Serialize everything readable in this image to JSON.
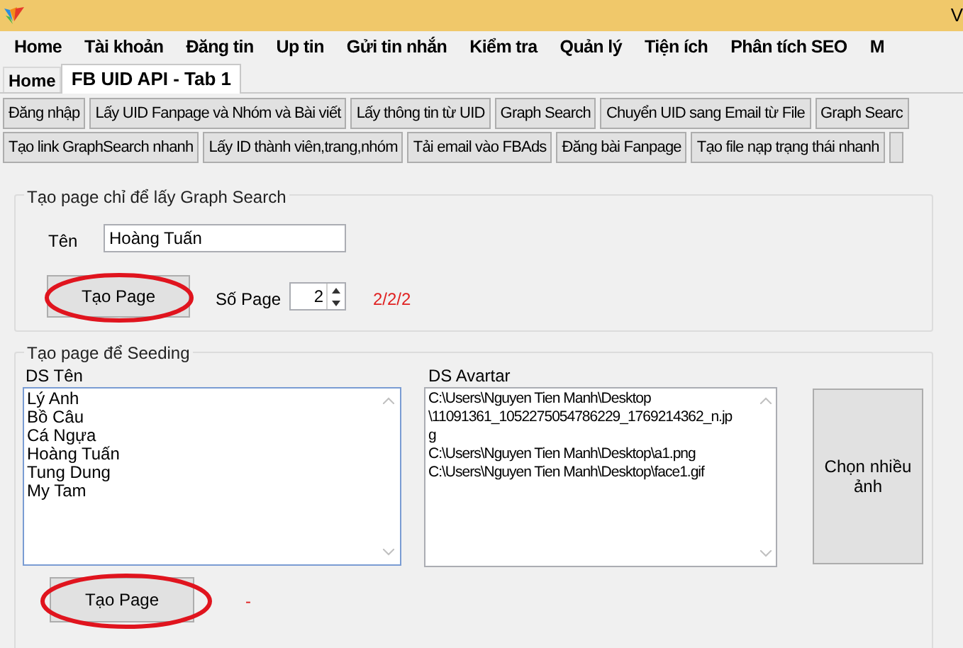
{
  "window": {
    "title": "V"
  },
  "menu": [
    {
      "label": "Home"
    },
    {
      "label": "Tài khoản"
    },
    {
      "label": "Đăng tin"
    },
    {
      "label": "Up tin"
    },
    {
      "label": "Gửi tin nhắn"
    },
    {
      "label": "Kiểm tra"
    },
    {
      "label": "Quản lý"
    },
    {
      "label": "Tiện ích"
    },
    {
      "label": "Phân tích SEO"
    },
    {
      "label": "M"
    }
  ],
  "tabs": [
    {
      "label": "Home",
      "selected": false
    },
    {
      "label": "FB UID API - Tab 1",
      "selected": true
    }
  ],
  "toolbar_rows": [
    [
      "Đăng nhập",
      "Lấy UID Fanpage và Nhóm và Bài viết",
      "Lấy thông tin từ UID",
      "Graph Search",
      "Chuyển UID sang Email từ File",
      "Graph Searc"
    ],
    [
      "Tạo link GraphSearch nhanh",
      "Lấy ID thành viên,trang,nhóm",
      "Tải email vào FBAds",
      "Đăng bài Fanpage",
      "Tạo file nạp trạng thái nhanh",
      ""
    ]
  ],
  "graph_group": {
    "legend": "Tạo page chỉ để lấy Graph Search",
    "name_label": "Tên",
    "name_value": "Hoàng Tuấn",
    "create_button": {
      "label": "Tạo Page",
      "circled": true
    },
    "count_label": "Số Page",
    "count_value": "2",
    "status": "2/2/2"
  },
  "seeding_group": {
    "legend": "Tạo page để Seeding",
    "names_label": "DS Tên",
    "names": [
      "Lý Anh",
      "Bồ Câu",
      "Cá Ngựa",
      "Hoàng Tuấn",
      "Tung Dung",
      "My Tam"
    ],
    "avatars_label": "DS Avartar",
    "avatars": [
      "C:\\Users\\Nguyen Tien Manh\\Desktop",
      "\\11091361_1052275054786229_1769214362_n.jp",
      "g",
      "C:\\Users\\Nguyen Tien Manh\\Desktop\\a1.png",
      "C:\\Users\\Nguyen Tien Manh\\Desktop\\face1.gif"
    ],
    "pick_button": "Chọn nhiều ảnh",
    "create_button": {
      "label": "Tạo Page",
      "circled": true
    },
    "status": "-"
  }
}
